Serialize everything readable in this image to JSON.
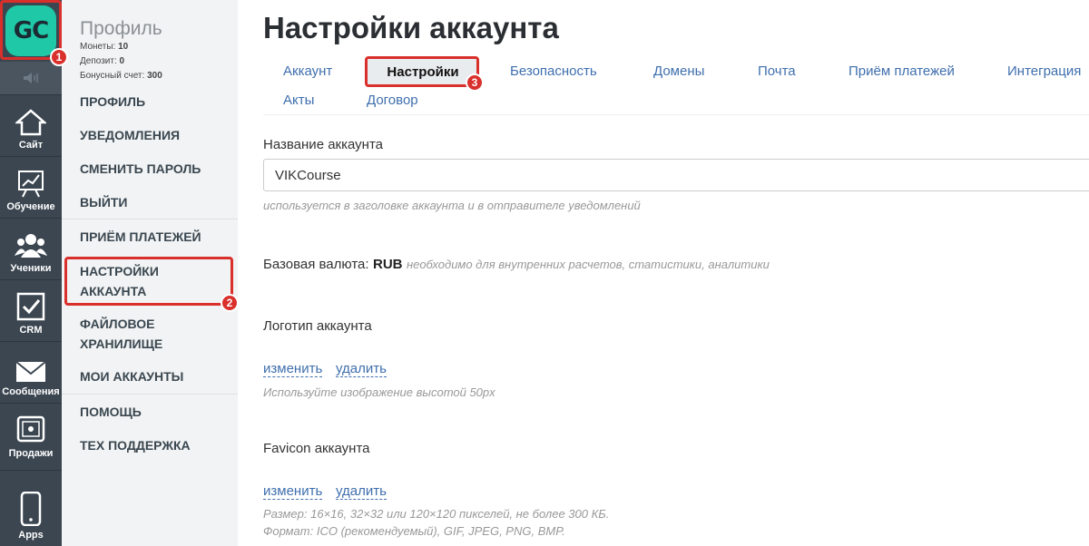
{
  "logo": {
    "text": "GC"
  },
  "rail": {
    "items": [
      {
        "label": "Сайт",
        "icon": "home-icon"
      },
      {
        "label": "Обучение",
        "icon": "chart-icon"
      },
      {
        "label": "Ученики",
        "icon": "users-icon"
      },
      {
        "label": "CRM",
        "icon": "checkbox-icon"
      },
      {
        "label": "Сообщения",
        "icon": "mail-icon"
      },
      {
        "label": "Продажи",
        "icon": "safe-icon"
      },
      {
        "label": "Apps",
        "icon": "phone-icon"
      }
    ]
  },
  "menu": {
    "title": "Профиль",
    "coins_label": "Монеты:",
    "coins_value": "10",
    "deposit_label": "Депозит:",
    "deposit_value": "0",
    "bonus_label": "Бонусный счет:",
    "bonus_value": "300",
    "items": {
      "profile": "ПРОФИЛЬ",
      "notifications": "УВЕДОМЛЕНИЯ",
      "change_password": "СМЕНИТЬ ПАРОЛЬ",
      "logout": "ВЫЙТИ",
      "payments": "ПРИЁМ ПЛАТЕЖЕЙ",
      "account_settings_1": "НАСТРОЙКИ",
      "account_settings_2": "АККАУНТА",
      "file_storage_1": "ФАЙЛОВОЕ",
      "file_storage_2": "ХРАНИЛИЩЕ",
      "my_accounts": "МОИ АККАУНТЫ",
      "help": "ПОМОЩЬ",
      "support": "ТЕХ ПОДДЕРЖКА"
    }
  },
  "page": {
    "title": "Настройки аккаунта",
    "tabs": {
      "account": "Аккаунт",
      "settings": "Настройки",
      "security": "Безопасность",
      "domains": "Домены",
      "mail": "Почта",
      "payments": "Приём платежей",
      "integration": "Интеграция",
      "acts": "Акты",
      "contract": "Договор"
    },
    "account_name_label": "Название аккаунта",
    "account_name_value": "VIKCourse",
    "account_name_hint": "используется в заголовке аккаунта и в отправителе уведомлений",
    "currency_label": "Базовая валюта:",
    "currency_value": "RUB",
    "currency_hint": "необходимо для внутренних расчетов, статистики, аналитики",
    "logo_label": "Логотип аккаунта",
    "change_link": "изменить",
    "delete_link": "удалить",
    "logo_hint": "Используйте изображение высотой 50px",
    "favicon_label": "Favicon аккаунта",
    "favicon_hint_1": "Размер: 16×16, 32×32 или 120×120 пикселей, не более 300 КБ.",
    "favicon_hint_2": "Формат: ICO (рекомендуемый), GIF, JPEG, PNG, BMP."
  },
  "annotations": {
    "b1": "1",
    "b2": "2",
    "b3": "3"
  },
  "colors": {
    "rail": "#3b4651",
    "accent": "#1fc8a6",
    "link": "#3f6fae",
    "highlight": "#d9302c"
  }
}
